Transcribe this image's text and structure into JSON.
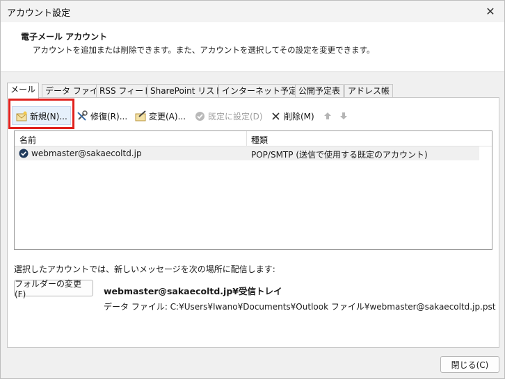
{
  "window": {
    "title": "アカウント設定",
    "close_glyph": "✕"
  },
  "header": {
    "title": "電子メール アカウント",
    "description": "アカウントを追加または削除できます。また、アカウントを選択してその設定を変更できます。"
  },
  "tabs": [
    {
      "label": "メール",
      "active": true
    },
    {
      "label": "データ ファイル"
    },
    {
      "label": "RSS フィード"
    },
    {
      "label": "SharePoint リスト"
    },
    {
      "label": "インターネット予定表"
    },
    {
      "label": "公開予定表"
    },
    {
      "label": "アドレス帳"
    }
  ],
  "toolbar": {
    "new_label": "新規(N)...",
    "repair_label": "修復(R)...",
    "change_label": "変更(A)...",
    "set_default_label": "既定に設定(D)",
    "delete_label": "削除(M)",
    "icons": [
      "new-account-icon",
      "repair-icon",
      "change-icon",
      "checkmark-circle-icon",
      "delete-x-icon",
      "arrow-up-icon",
      "arrow-down-icon"
    ]
  },
  "accounts": {
    "columns": {
      "name": "名前",
      "type": "種類"
    },
    "rows": [
      {
        "name": "webmaster@sakaecoltd.jp",
        "type": "POP/SMTP (送信で使用する既定のアカウント)"
      }
    ]
  },
  "delivery": {
    "label": "選択したアカウントでは、新しいメッセージを次の場所に配信します:",
    "folder_button": "フォルダーの変更(F)",
    "target": "webmaster@sakaecoltd.jp¥受信トレイ",
    "data_file": "データ ファイル: C:¥Users¥Iwano¥Documents¥Outlook ファイル¥webmaster@sakaecoltd.jp.pst"
  },
  "footer": {
    "close_button": "閉じる(C)"
  },
  "colors": {
    "highlight": "#e0201c",
    "default_check": "#1f3a5c"
  }
}
